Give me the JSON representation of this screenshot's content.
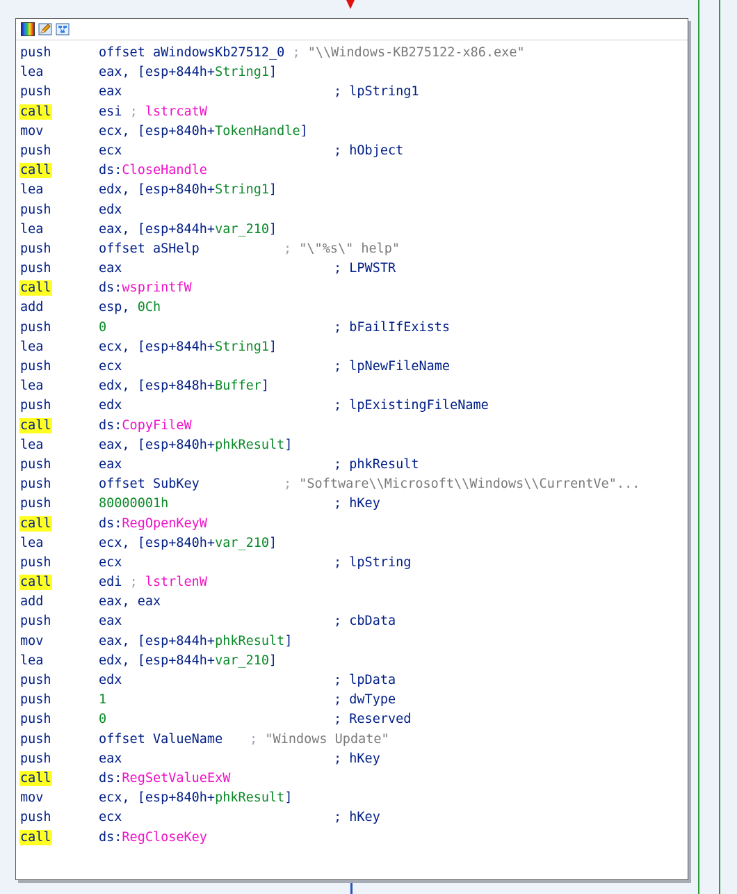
{
  "toolbar": {
    "icons": [
      "graph-colors-icon",
      "edit-node-icon",
      "graph-overview-icon"
    ]
  },
  "colors": {
    "background": "#eef3f9",
    "call_highlight": "#ffff22",
    "instruction": "#001e87",
    "import_name": "#ee10c8",
    "stack_var": "#0a8a28",
    "string_literal": "#7a7a7a",
    "edge_red": "#e01010",
    "edge_green": "#2c9b3a"
  },
  "rows": [
    {
      "m": "push",
      "o": [
        {
          "t": "offset aWindowsKb27512_0",
          "c": "blu"
        }
      ],
      "k": [
        {
          "t": " ; ",
          "c": "semi"
        },
        {
          "t": "\"\\\\Windows-KB275122-x86.exe\"",
          "c": "str"
        }
      ],
      "wide": true
    },
    {
      "m": "lea",
      "o": [
        {
          "t": "eax, [esp+844h+",
          "c": "blu"
        },
        {
          "t": "String1",
          "c": "grn"
        },
        {
          "t": "]",
          "c": "blu"
        }
      ]
    },
    {
      "m": "push",
      "o": [
        {
          "t": "eax",
          "c": "blu"
        }
      ],
      "k": [
        {
          "t": "; lpString1",
          "c": "blu"
        }
      ]
    },
    {
      "m": "call",
      "hl": true,
      "o": [
        {
          "t": "esi ",
          "c": "blu"
        },
        {
          "t": "; ",
          "c": "semi"
        },
        {
          "t": "lstrcatW",
          "c": "mag"
        }
      ]
    },
    {
      "m": "mov",
      "o": [
        {
          "t": "ecx, [esp+840h+",
          "c": "blu"
        },
        {
          "t": "TokenHandle",
          "c": "grn"
        },
        {
          "t": "]",
          "c": "blu"
        }
      ]
    },
    {
      "m": "push",
      "o": [
        {
          "t": "ecx",
          "c": "blu"
        }
      ],
      "k": [
        {
          "t": "; hObject",
          "c": "blu"
        }
      ]
    },
    {
      "m": "call",
      "hl": true,
      "o": [
        {
          "t": "ds:",
          "c": "blu"
        },
        {
          "t": "CloseHandle",
          "c": "mag"
        }
      ]
    },
    {
      "m": "lea",
      "o": [
        {
          "t": "edx, [esp+840h+",
          "c": "blu"
        },
        {
          "t": "String1",
          "c": "grn"
        },
        {
          "t": "]",
          "c": "blu"
        }
      ]
    },
    {
      "m": "push",
      "o": [
        {
          "t": "edx",
          "c": "blu"
        }
      ]
    },
    {
      "m": "lea",
      "o": [
        {
          "t": "eax, [esp+844h+",
          "c": "blu"
        },
        {
          "t": "var_210",
          "c": "grn"
        },
        {
          "t": "]",
          "c": "blu"
        }
      ]
    },
    {
      "m": "push",
      "o": [
        {
          "t": "offset aSHelp",
          "c": "blu"
        }
      ],
      "k": [
        {
          "t": "; ",
          "c": "semi"
        },
        {
          "t": "\"\\\"%s\\\" help\"",
          "c": "str"
        }
      ],
      "kx": 385
    },
    {
      "m": "push",
      "o": [
        {
          "t": "eax",
          "c": "blu"
        }
      ],
      "k": [
        {
          "t": "; LPWSTR",
          "c": "blu"
        }
      ]
    },
    {
      "m": "call",
      "hl": true,
      "o": [
        {
          "t": "ds:",
          "c": "blu"
        },
        {
          "t": "wsprintfW",
          "c": "mag"
        }
      ]
    },
    {
      "m": "add",
      "o": [
        {
          "t": "esp, ",
          "c": "blu"
        },
        {
          "t": "0Ch",
          "c": "grn"
        }
      ]
    },
    {
      "m": "push",
      "o": [
        {
          "t": "0",
          "c": "grn"
        }
      ],
      "k": [
        {
          "t": "; bFailIfExists",
          "c": "blu"
        }
      ]
    },
    {
      "m": "lea",
      "o": [
        {
          "t": "ecx, [esp+844h+",
          "c": "blu"
        },
        {
          "t": "String1",
          "c": "grn"
        },
        {
          "t": "]",
          "c": "blu"
        }
      ]
    },
    {
      "m": "push",
      "o": [
        {
          "t": "ecx",
          "c": "blu"
        }
      ],
      "k": [
        {
          "t": "; lpNewFileName",
          "c": "blu"
        }
      ]
    },
    {
      "m": "lea",
      "o": [
        {
          "t": "edx, [esp+848h+",
          "c": "blu"
        },
        {
          "t": "Buffer",
          "c": "grn"
        },
        {
          "t": "]",
          "c": "blu"
        }
      ]
    },
    {
      "m": "push",
      "o": [
        {
          "t": "edx",
          "c": "blu"
        }
      ],
      "k": [
        {
          "t": "; lpExistingFileName",
          "c": "blu"
        }
      ]
    },
    {
      "m": "call",
      "hl": true,
      "o": [
        {
          "t": "ds:",
          "c": "blu"
        },
        {
          "t": "CopyFileW",
          "c": "mag"
        }
      ]
    },
    {
      "m": "lea",
      "o": [
        {
          "t": "eax, [esp+840h+",
          "c": "blu"
        },
        {
          "t": "phkResult",
          "c": "grn"
        },
        {
          "t": "]",
          "c": "blu"
        }
      ]
    },
    {
      "m": "push",
      "o": [
        {
          "t": "eax",
          "c": "blu"
        }
      ],
      "k": [
        {
          "t": "; phkResult",
          "c": "blu"
        }
      ]
    },
    {
      "m": "push",
      "o": [
        {
          "t": "offset SubKey",
          "c": "blu"
        }
      ],
      "k": [
        {
          "t": "; ",
          "c": "semi"
        },
        {
          "t": "\"Software\\\\Microsoft\\\\Windows\\\\CurrentVe\"...",
          "c": "str"
        }
      ],
      "kx": 385
    },
    {
      "m": "push",
      "o": [
        {
          "t": "80000001h",
          "c": "grn"
        }
      ],
      "k": [
        {
          "t": "; hKey",
          "c": "blu"
        }
      ]
    },
    {
      "m": "call",
      "hl": true,
      "o": [
        {
          "t": "ds:",
          "c": "blu"
        },
        {
          "t": "RegOpenKeyW",
          "c": "mag"
        }
      ]
    },
    {
      "m": "lea",
      "o": [
        {
          "t": "ecx, [esp+840h+",
          "c": "blu"
        },
        {
          "t": "var_210",
          "c": "grn"
        },
        {
          "t": "]",
          "c": "blu"
        }
      ]
    },
    {
      "m": "push",
      "o": [
        {
          "t": "ecx",
          "c": "blu"
        }
      ],
      "k": [
        {
          "t": "; lpString",
          "c": "blu"
        }
      ]
    },
    {
      "m": "call",
      "hl": true,
      "o": [
        {
          "t": "edi ",
          "c": "blu"
        },
        {
          "t": "; ",
          "c": "semi"
        },
        {
          "t": "lstrlenW",
          "c": "mag"
        }
      ]
    },
    {
      "m": "add",
      "o": [
        {
          "t": "eax, eax",
          "c": "blu"
        }
      ]
    },
    {
      "m": "push",
      "o": [
        {
          "t": "eax",
          "c": "blu"
        }
      ],
      "k": [
        {
          "t": "; cbData",
          "c": "blu"
        }
      ]
    },
    {
      "m": "mov",
      "o": [
        {
          "t": "eax, [esp+844h+",
          "c": "blu"
        },
        {
          "t": "phkResult",
          "c": "grn"
        },
        {
          "t": "]",
          "c": "blu"
        }
      ]
    },
    {
      "m": "lea",
      "o": [
        {
          "t": "edx, [esp+844h+",
          "c": "blu"
        },
        {
          "t": "var_210",
          "c": "grn"
        },
        {
          "t": "]",
          "c": "blu"
        }
      ]
    },
    {
      "m": "push",
      "o": [
        {
          "t": "edx",
          "c": "blu"
        }
      ],
      "k": [
        {
          "t": "; lpData",
          "c": "blu"
        }
      ]
    },
    {
      "m": "push",
      "o": [
        {
          "t": "1",
          "c": "grn"
        }
      ],
      "k": [
        {
          "t": "; dwType",
          "c": "blu"
        }
      ]
    },
    {
      "m": "push",
      "o": [
        {
          "t": "0",
          "c": "grn"
        }
      ],
      "k": [
        {
          "t": "; Reserved",
          "c": "blu"
        }
      ]
    },
    {
      "m": "push",
      "o": [
        {
          "t": "offset ValueName",
          "c": "blu"
        }
      ],
      "k": [
        {
          "t": " ; ",
          "c": "semi"
        },
        {
          "t": "\"Windows Update\"",
          "c": "str"
        }
      ],
      "kx": 325
    },
    {
      "m": "push",
      "o": [
        {
          "t": "eax",
          "c": "blu"
        }
      ],
      "k": [
        {
          "t": "; hKey",
          "c": "blu"
        }
      ]
    },
    {
      "m": "call",
      "hl": true,
      "o": [
        {
          "t": "ds:",
          "c": "blu"
        },
        {
          "t": "RegSetValueExW",
          "c": "mag"
        }
      ]
    },
    {
      "m": "mov",
      "o": [
        {
          "t": "ecx, [esp+840h+",
          "c": "blu"
        },
        {
          "t": "phkResult",
          "c": "grn"
        },
        {
          "t": "]",
          "c": "blu"
        }
      ]
    },
    {
      "m": "push",
      "o": [
        {
          "t": "ecx",
          "c": "blu"
        }
      ],
      "k": [
        {
          "t": "; hKey",
          "c": "blu"
        }
      ]
    },
    {
      "m": "call",
      "hl": true,
      "o": [
        {
          "t": "ds:",
          "c": "blu"
        },
        {
          "t": "RegCloseKey",
          "c": "mag"
        }
      ]
    }
  ]
}
